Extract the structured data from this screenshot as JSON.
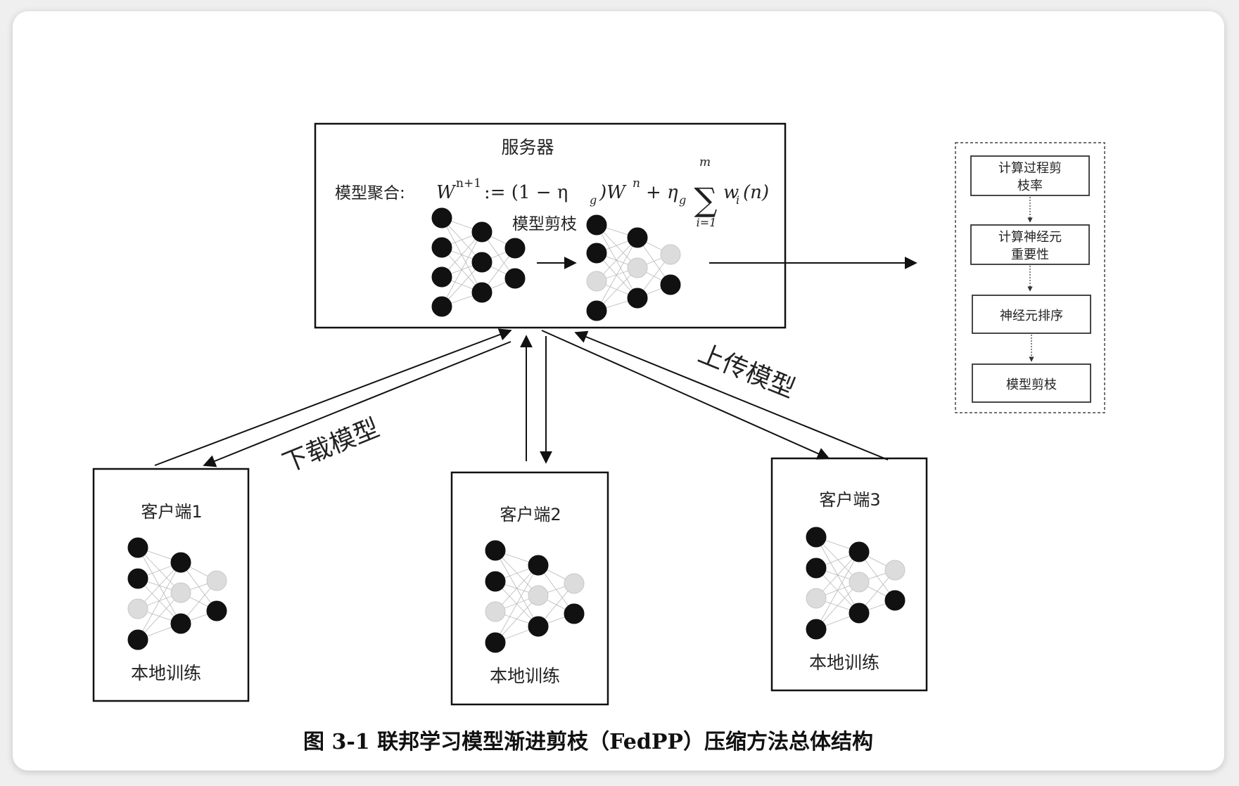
{
  "server": {
    "title": "服务器",
    "aggregation_label": "模型聚合:",
    "formula": {
      "lhs": "W",
      "lhs_sup": "n+1",
      "assign": ":= (1 − η",
      "eta_sub": "g",
      "mid": ")W",
      "mid_sup": "n",
      "plus": "+ η",
      "eta2_sub": "g",
      "sum_top": "m",
      "sum_bottom": "i=1",
      "term": "w",
      "term_sub": "i",
      "term_arg": "(n)"
    },
    "pruning_label": "模型剪枝"
  },
  "arrows": {
    "download_label": "下载模型",
    "upload_label": "上传模型"
  },
  "clients": [
    {
      "title": "客户端1",
      "footer": "本地训练"
    },
    {
      "title": "客户端2",
      "footer": "本地训练"
    },
    {
      "title": "客户端3",
      "footer": "本地训练"
    }
  ],
  "process": {
    "steps": [
      {
        "line1": "计算过程剪",
        "line2": "枝率"
      },
      {
        "line1": "计算神经元",
        "line2": "重要性"
      },
      {
        "line1": "神经元排序",
        "line2": ""
      },
      {
        "line1": "模型剪枝",
        "line2": ""
      }
    ]
  },
  "caption": "图 3-1  联邦学习模型渐进剪枝（FedPP）压缩方法总体结构",
  "colors": {
    "active_neuron": "#111111",
    "pruned_neuron": "#dcdcdc",
    "line": "#111111"
  }
}
